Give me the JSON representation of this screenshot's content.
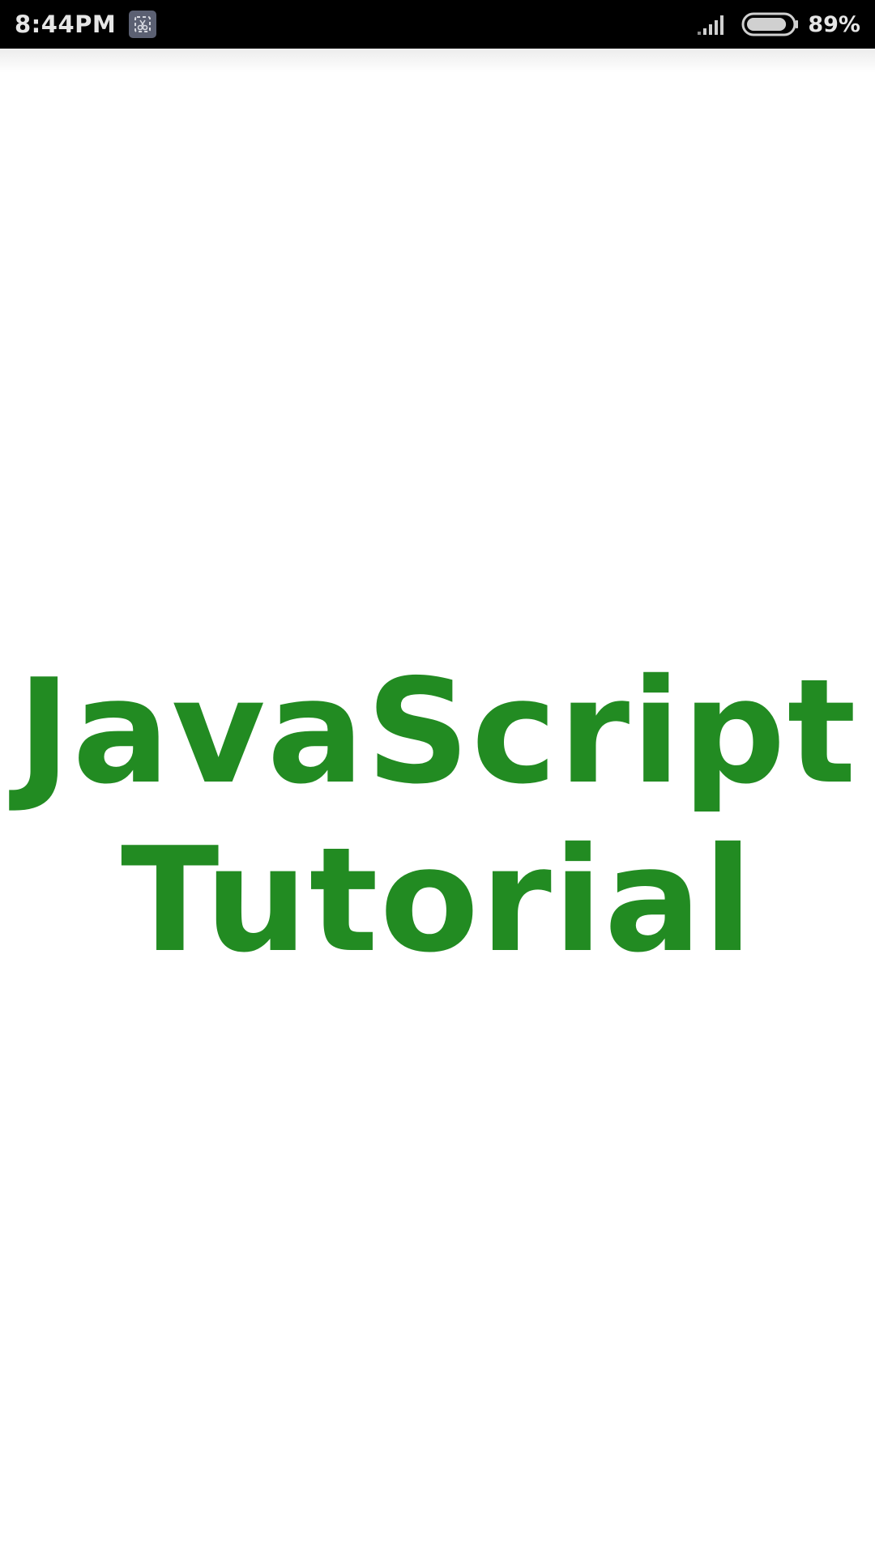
{
  "status_bar": {
    "time": "8:44PM",
    "battery_percent": "89%",
    "battery_level": 0.89,
    "signal_icon": "signal-bars-icon",
    "notification_icon": "screenshot-app-icon",
    "battery_icon": "battery-icon"
  },
  "splash": {
    "title_line1": "JavaScript",
    "title_line2": "Tutorial"
  },
  "colors": {
    "accent": "#228b22",
    "status_bar_bg": "#000000",
    "status_bar_text": "#e6e6e6",
    "background": "#ffffff"
  }
}
